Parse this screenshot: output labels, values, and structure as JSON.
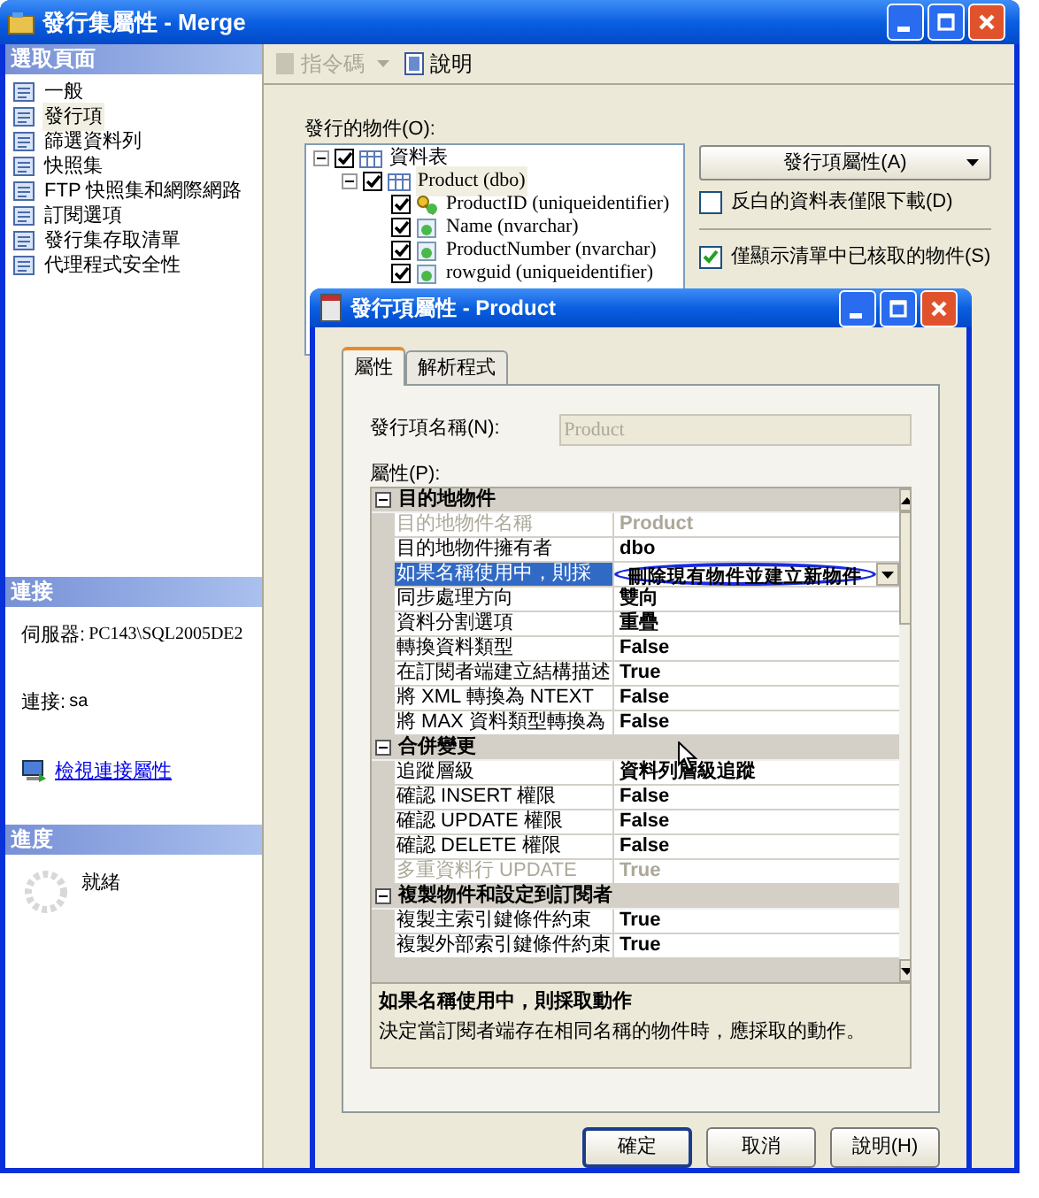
{
  "main_window": {
    "title": "發行集屬性 - Merge"
  },
  "sidebar": {
    "header": "選取頁面",
    "items": [
      {
        "label": "一般",
        "selected": false
      },
      {
        "label": "發行項",
        "selected": true
      },
      {
        "label": "篩選資料列",
        "selected": false
      },
      {
        "label": "快照集",
        "selected": false
      },
      {
        "label": "FTP 快照集和網際網路",
        "selected": false
      },
      {
        "label": "訂閱選項",
        "selected": false
      },
      {
        "label": "發行集存取清單",
        "selected": false
      },
      {
        "label": "代理程式安全性",
        "selected": false
      }
    ]
  },
  "connection": {
    "header": "連接",
    "server_label": "伺服器:",
    "server": "PC143\\SQL2005DE2",
    "login_label": "連接:",
    "login": "sa",
    "link": "檢視連接屬性"
  },
  "progress": {
    "header": "進度",
    "status": "就緒"
  },
  "toolbar": [
    {
      "label": "指令碼",
      "disabled": true,
      "dropdown": true
    },
    {
      "label": "說明",
      "disabled": false,
      "dropdown": false
    }
  ],
  "objects": {
    "label": "發行的物件(O):",
    "tree": [
      {
        "label": "資料表",
        "kind": "folder",
        "checked": true,
        "expanded": true,
        "selected": false,
        "children": [
          {
            "label": "Product (dbo)",
            "kind": "table",
            "checked": true,
            "expanded": true,
            "selected": true,
            "children": [
              {
                "label": "ProductID (uniqueidentifier)",
                "kind": "key",
                "checked": true,
                "selected": false
              },
              {
                "label": "Name (nvarchar)",
                "kind": "column",
                "checked": true,
                "selected": false
              },
              {
                "label": "ProductNumber (nvarchar)",
                "kind": "column",
                "checked": true,
                "selected": false
              },
              {
                "label": "rowguid (uniqueidentifier)",
                "kind": "column",
                "checked": true,
                "selected": false
              }
            ]
          }
        ]
      }
    ]
  },
  "article_properties_button": "發行項屬性(A)",
  "options": [
    {
      "label": "反白的資料表僅限下載(D)",
      "checked": false
    },
    {
      "label": "僅顯示清單中已核取的物件(S)",
      "checked": true
    }
  ],
  "dialog": {
    "title": "發行項屬性 - Product",
    "tabs": [
      {
        "label": "屬性",
        "selected": true
      },
      {
        "label": "解析程式",
        "selected": false
      }
    ],
    "name_label": "發行項名稱(N):",
    "name_value": "Product",
    "name_disabled": true,
    "grid_label": "屬性(P):",
    "grid": [
      {
        "kind": "category",
        "label": "目的地物件",
        "expanded": true
      },
      {
        "kind": "property",
        "label": "目的地物件名稱",
        "value": "Product",
        "disabled": true,
        "selected": false
      },
      {
        "kind": "property",
        "label": "目的地物件擁有者",
        "value": "dbo",
        "disabled": false,
        "selected": false
      },
      {
        "kind": "property",
        "label": "如果名稱使用中，則採",
        "value": "刪除現有物件並建立新物件",
        "disabled": false,
        "selected": true
      },
      {
        "kind": "property",
        "label": "同步處理方向",
        "value": "雙向",
        "disabled": false,
        "selected": false
      },
      {
        "kind": "property",
        "label": "資料分割選項",
        "value": "重疊",
        "disabled": false,
        "selected": false
      },
      {
        "kind": "property",
        "label": "轉換資料類型",
        "value": "False",
        "disabled": false,
        "selected": false
      },
      {
        "kind": "property",
        "label": "在訂閱者端建立結構描述",
        "value": "True",
        "disabled": false,
        "selected": false
      },
      {
        "kind": "property",
        "label": "將 XML 轉換為 NTEXT",
        "value": "False",
        "disabled": false,
        "selected": false
      },
      {
        "kind": "property",
        "label": "將 MAX 資料類型轉換為",
        "value": "False",
        "disabled": false,
        "selected": false
      },
      {
        "kind": "category",
        "label": "合併變更",
        "expanded": true
      },
      {
        "kind": "property",
        "label": "追蹤層級",
        "value": "資料列層級追蹤",
        "disabled": false,
        "selected": false
      },
      {
        "kind": "property",
        "label": "確認 INSERT 權限",
        "value": "False",
        "disabled": false,
        "selected": false
      },
      {
        "kind": "property",
        "label": "確認 UPDATE 權限",
        "value": "False",
        "disabled": false,
        "selected": false
      },
      {
        "kind": "property",
        "label": "確認 DELETE 權限",
        "value": "False",
        "disabled": false,
        "selected": false
      },
      {
        "kind": "property",
        "label": "多重資料行 UPDATE",
        "value": "True",
        "disabled": true,
        "selected": false
      },
      {
        "kind": "category",
        "label": "複製物件和設定到訂閱者",
        "expanded": true
      },
      {
        "kind": "property",
        "label": "複製主索引鍵條件約束",
        "value": "True",
        "disabled": false,
        "selected": false
      },
      {
        "kind": "property",
        "label": "複製外部索引鍵條件約束",
        "value": "True",
        "disabled": false,
        "selected": false
      }
    ],
    "description": {
      "title": "如果名稱使用中，則採取動作",
      "text": "決定當訂閱者端存在相同名稱的物件時，應採取的動作。"
    },
    "buttons": [
      {
        "label": "確定",
        "default": true
      },
      {
        "label": "取消",
        "default": false
      },
      {
        "label": "說明(H)",
        "default": false
      }
    ]
  }
}
